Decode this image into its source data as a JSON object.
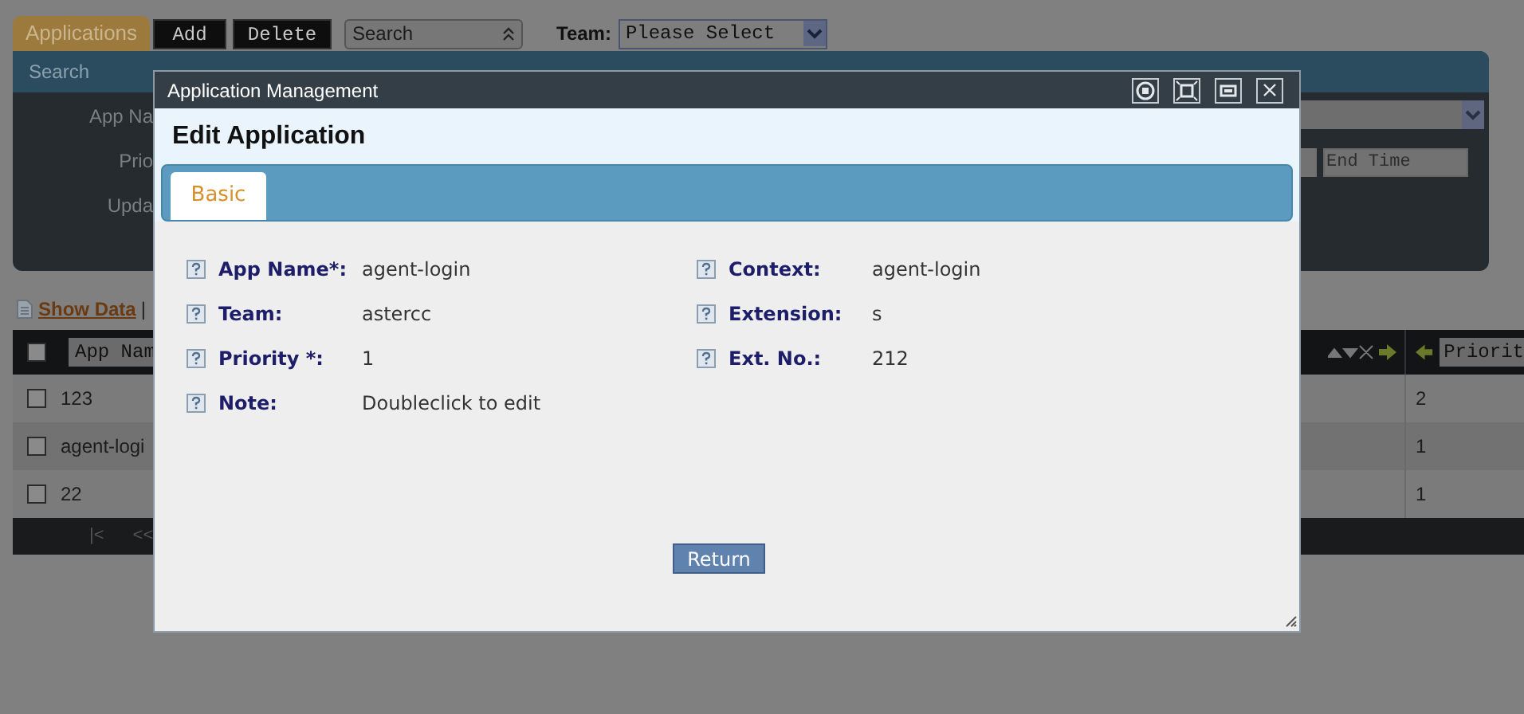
{
  "toolbar": {
    "tabs": [
      {
        "label": "Applications",
        "selected": true
      }
    ],
    "buttons": [
      "Add",
      "Delete"
    ],
    "search_select": "Search",
    "team_label": "Team:",
    "team_select": "Please Select"
  },
  "search_panel": {
    "title": "Search",
    "labels": [
      "App Na",
      "Prio",
      "Upda"
    ],
    "end_time_placeholder": "End Time"
  },
  "show_data_link": "Show Data",
  "link_separator": "|",
  "table": {
    "header_checked": false,
    "columns": [
      "App Nam",
      "Priorit"
    ],
    "rows": [
      {
        "checked": false,
        "app_name": "123",
        "priority": "2"
      },
      {
        "checked": false,
        "app_name": "agent-logi",
        "priority": "1"
      },
      {
        "checked": false,
        "app_name": "22",
        "priority": "1"
      }
    ],
    "pager": [
      "|<",
      "<<"
    ]
  },
  "dialog": {
    "title": "Application Management",
    "heading": "Edit Application",
    "tabs": [
      {
        "label": "Basic",
        "selected": true
      }
    ],
    "fields": [
      {
        "label": "App Name*:",
        "value": "agent-login"
      },
      {
        "label": "Context:",
        "value": "agent-login"
      },
      {
        "label": "Team:",
        "value": "astercc"
      },
      {
        "label": "Extension:",
        "value": "s"
      },
      {
        "label": "Priority *:",
        "value": "1"
      },
      {
        "label": "Ext. No.:",
        "value": "212"
      },
      {
        "label": "Note:",
        "value": "Doubleclick to edit"
      }
    ],
    "button": "Return"
  }
}
